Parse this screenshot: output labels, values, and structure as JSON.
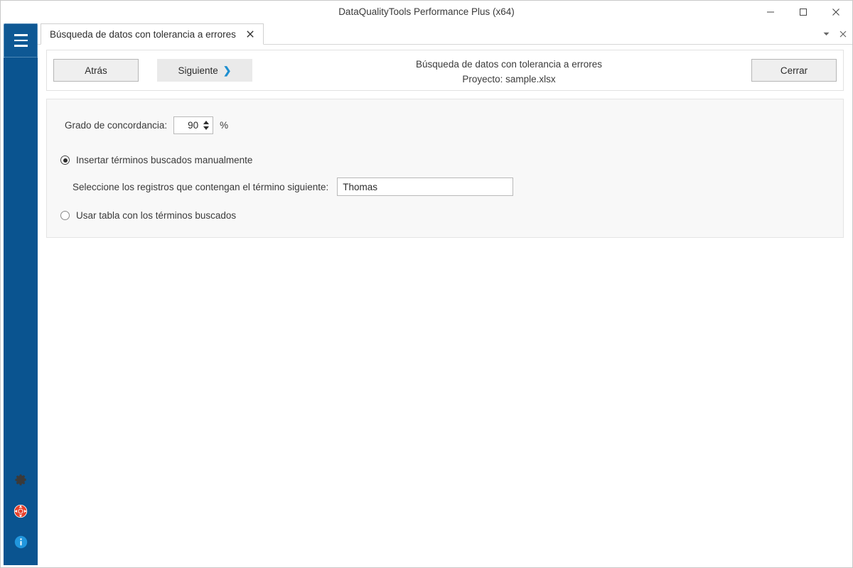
{
  "window": {
    "title": "DataQualityTools Performance Plus (x64)",
    "controls": [
      {
        "name": "minimize-button",
        "icon": "minimize-icon"
      },
      {
        "name": "maximize-button",
        "icon": "maximize-icon"
      },
      {
        "name": "close-button",
        "icon": "close-icon"
      }
    ]
  },
  "sidebar": {
    "menu_button": "menu-icon",
    "icons": [
      {
        "name": "settings-icon",
        "label": "gear-icon"
      },
      {
        "name": "support-icon",
        "label": "lifebuoy-icon"
      },
      {
        "name": "info-icon",
        "label": "info-icon"
      }
    ],
    "color": "#0a5490"
  },
  "tabs": {
    "items": [
      {
        "label": "Búsqueda de datos con tolerancia a errores",
        "active": true,
        "close": "✕"
      }
    ],
    "list_caret": "▾",
    "close_all": "✕"
  },
  "toolbar": {
    "back_label": "Atrás",
    "next_label": "Siguiente",
    "next_chevron": "❯",
    "close_label": "Cerrar",
    "heading": "Búsqueda de datos con tolerancia a errores",
    "subheading": "Proyecto: sample.xlsx",
    "accent_color": "#1e8fd0"
  },
  "panel": {
    "match_label": "Grado de concordancia:",
    "match_value": "90",
    "match_unit": "%",
    "spinner_up": "▴",
    "spinner_down": "▾",
    "option_manual": "Insertar términos buscados manualmente",
    "option_table": "Usar tabla con los términos buscados",
    "term_label": "Seleccione los registros que contengan el término siguiente:",
    "term_value": "Thomas",
    "term_placeholder": ""
  }
}
